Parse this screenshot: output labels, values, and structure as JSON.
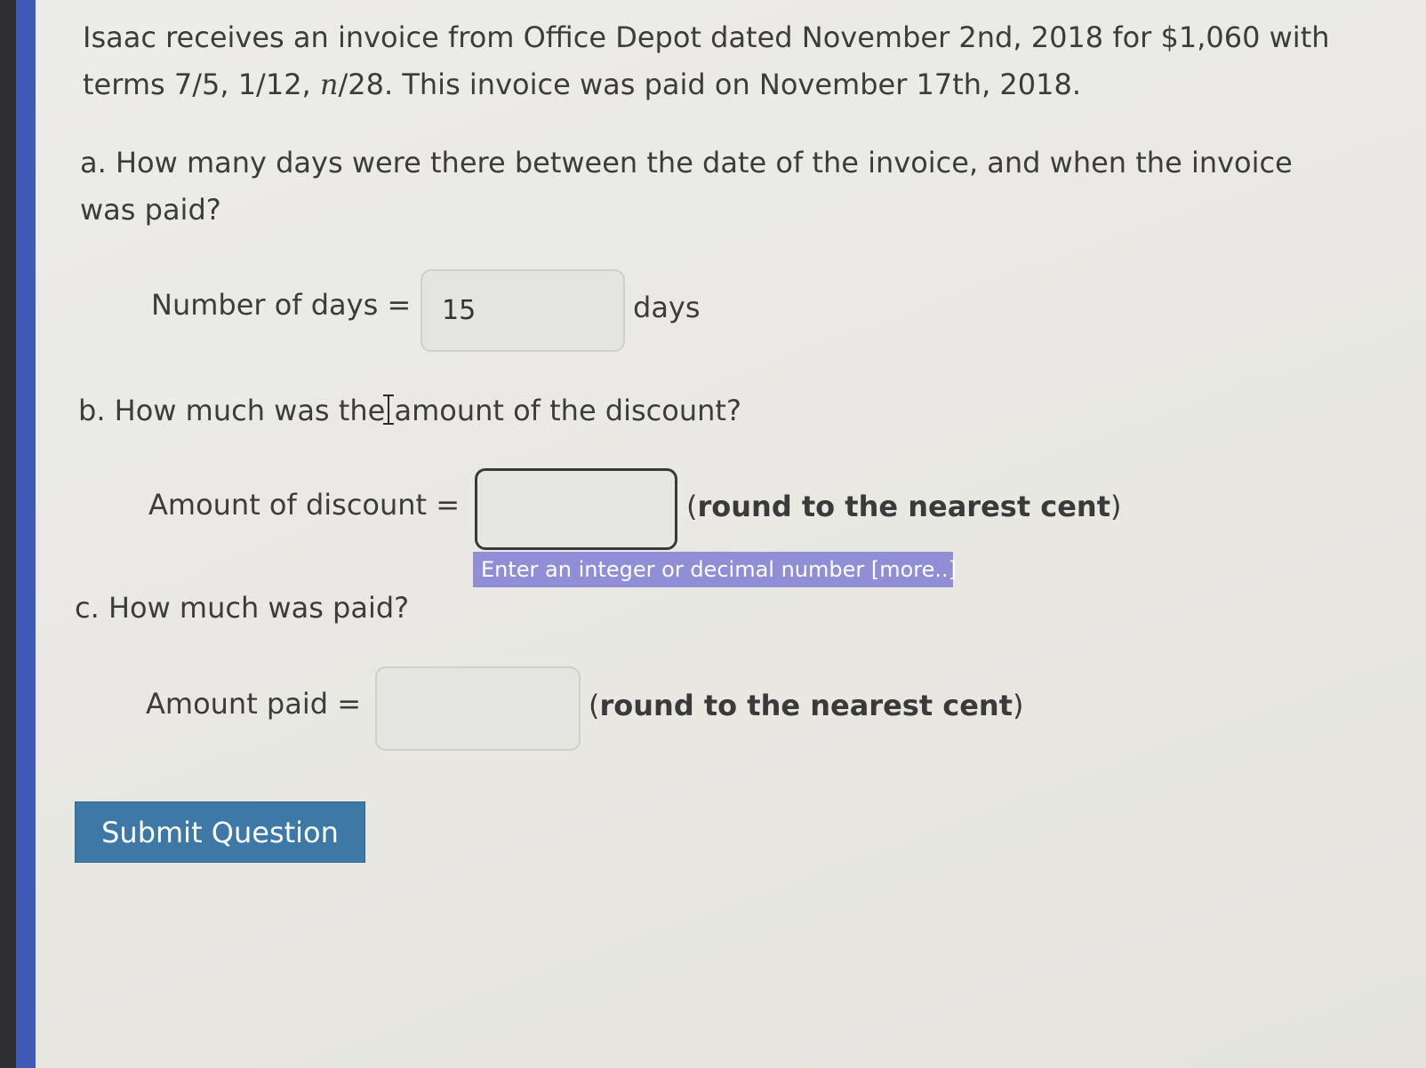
{
  "problem": {
    "line1": "Isaac receives an invoice from Office Depot dated November 2nd, 2018 for $1,060 with",
    "line2_pre": "terms 7/5, 1/12, ",
    "line2_var": "n",
    "line2_post": "/28. This invoice was paid on November 17th, 2018."
  },
  "part_a": {
    "question_line1": "a. How many days were there between the date of the invoice, and when the invoice",
    "question_line2": "was paid?",
    "label": "Number of days =",
    "value": "15",
    "unit": "days"
  },
  "part_b": {
    "question": "b. How much was the amount of the discount?",
    "label": "Amount of discount =",
    "value": "",
    "note_open": "(",
    "note_text": "round to the nearest cent",
    "note_close": ")",
    "tooltip": "Enter an integer or decimal number [more..]"
  },
  "part_c": {
    "question": "c. How much was paid?",
    "label": "Amount paid =",
    "value": "",
    "note_open": "(",
    "note_text": "round to the nearest cent",
    "note_close": ")"
  },
  "submit_label": "Submit Question",
  "accent_marks": [
    "C",
    "g",
    "C",
    "g"
  ]
}
